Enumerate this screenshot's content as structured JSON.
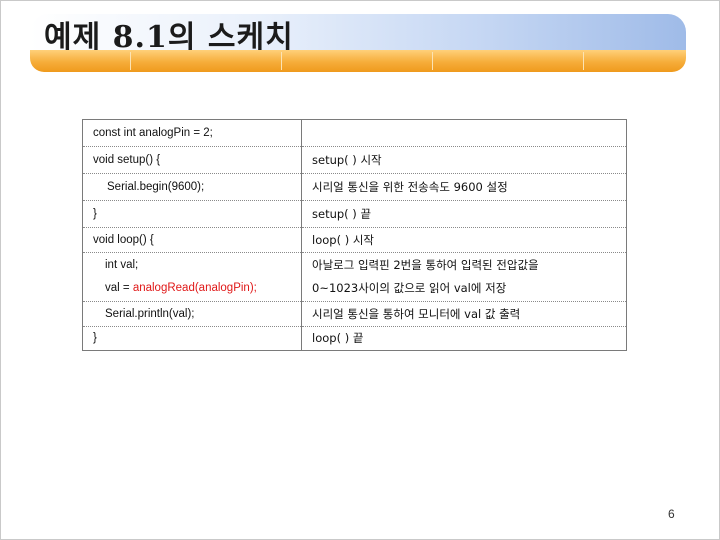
{
  "slide": {
    "title": "예제 8.1의 스케치",
    "page_number": "6"
  },
  "code_table": {
    "rows": [
      {
        "code": "const int analogPin = 2;",
        "desc": ""
      },
      {
        "code": "void setup() {",
        "desc": "setup( ) 시작"
      },
      {
        "code": "Serial.begin(9600);",
        "desc": "시리얼 통신을 위한 전송속도 9600 설정"
      },
      {
        "code": "}",
        "desc": "setup( ) 끝"
      },
      {
        "code": "void loop() {",
        "desc": "loop( ) 시작"
      },
      {
        "code_line1": "int val;",
        "code_line2_prefix": "val = ",
        "code_line2_highlight": "analogRead(analogPin);",
        "desc_line1": "아날로그 입력핀 2번을 통하여 입력된 전압값을",
        "desc_line2": "0~1023사이의 값으로 읽어 val에 저장"
      },
      {
        "code": "Serial.println(val);",
        "desc": "시리얼 통신을 통하여 모니터에 val 값 출력"
      },
      {
        "code": "}",
        "desc": "loop( ) 끝"
      }
    ]
  },
  "colors": {
    "highlight": "#e01818",
    "banner_orange": "#f6ad3a",
    "banner_blue": "#9fbbe8"
  }
}
